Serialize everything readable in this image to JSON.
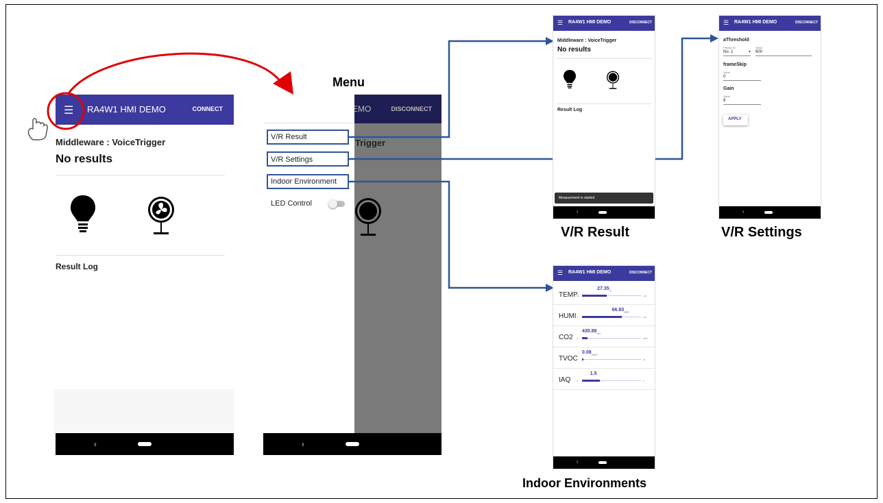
{
  "main_phone": {
    "app_title": "RA4W1 HMI DEMO",
    "connect_label": "CONNECT",
    "middleware_label": "Middleware : VoiceTrigger",
    "result_text": "No results",
    "result_log_label": "Result Log"
  },
  "menu_phone": {
    "caption": "Menu",
    "title_partial": "EMO",
    "disconnect_label": "DISCONNECT",
    "behind_text_partial": "Trigger",
    "menu_items": [
      "V/R Result",
      "V/R Settings",
      "Indoor Environment"
    ],
    "led_control_label": "LED Control"
  },
  "vr_result_phone": {
    "caption": "V/R Result",
    "app_title": "RA4W1 HMI DEMO",
    "disconnect_label": "DISCONNECT",
    "middleware_label": "Middleware : VoiceTrigger",
    "result_text": "No results",
    "result_log_label": "Result Log",
    "snackbar_text": "Measurement is started"
  },
  "vr_settings_phone": {
    "caption": "V/R Settings",
    "app_title": "RA4W1 HMI DEMO",
    "disconnect_label": "DISCONNECT",
    "athreshold_label": "aThreshold",
    "phrase_id_label": "Phrase ID",
    "phrase_id_value": "No. 1",
    "value_label": "Value",
    "athreshold_value": "600",
    "frameskip_label": "frameSkip",
    "frameskip_value_label": "Value",
    "frameskip_value": "0",
    "gain_label": "Gain",
    "gain_value_label": "Value",
    "gain_value": "8",
    "apply_label": "APPLY"
  },
  "indoor_phone": {
    "caption": "Indoor Environments",
    "app_title": "RA4W1 HMI DEMO",
    "disconnect_label": "DISCONNECT",
    "sensors": [
      {
        "name": "TEMP",
        "value": "27.35",
        "unit": "°C",
        "min": "-40",
        "max": "120",
        "level": 0.42
      },
      {
        "name": "HUMI",
        "value": "66.83",
        "unit": "%RH",
        "min": "0",
        "max": "100",
        "level": 0.67
      },
      {
        "name": "CO2",
        "value": "435.88",
        "unit": "ppm",
        "min": "0",
        "max": "5000",
        "level": 0.09
      },
      {
        "name": "TVOC",
        "value": "0.08",
        "unit": "mg/m3",
        "min": "0",
        "max": "10",
        "level": 0.01
      },
      {
        "name": "IAQ",
        "value": "1.5",
        "unit": "",
        "min": "0",
        "max": "5",
        "level": 0.3
      }
    ]
  },
  "colors": {
    "appbar": "#3c3a9e",
    "accent": "#3c3a9e",
    "highlight_red": "#e00000",
    "connector_blue": "#2f5597"
  }
}
